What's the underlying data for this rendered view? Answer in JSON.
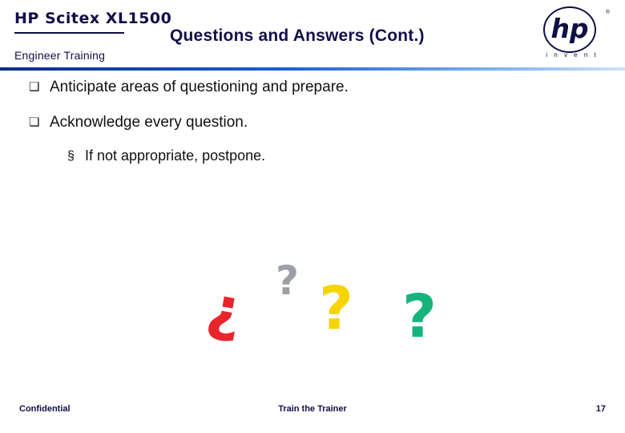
{
  "header": {
    "brand": "HP Scitex XL1500",
    "brand_sub": "Engineer  Training",
    "title": "Questions and Answers (Cont.)",
    "logo": {
      "letters": "hp",
      "tagline": "i n v e n t",
      "trademark": "®"
    },
    "accent_color": "#10104a",
    "bar_color": "#0a2c86"
  },
  "content": {
    "bullets": [
      {
        "level": 1,
        "marker": "❏",
        "text": "Anticipate areas of questioning and prepare."
      },
      {
        "level": 1,
        "marker": "❏",
        "text": "Acknowledge every question."
      },
      {
        "level": 2,
        "marker": "§",
        "text": "If not appropriate, postpone."
      }
    ]
  },
  "artwork": {
    "question_marks": [
      {
        "glyph": "?",
        "color": "#e8252a",
        "name": "question-mark-red"
      },
      {
        "glyph": "?",
        "color": "#9aa0a6",
        "name": "question-mark-gray"
      },
      {
        "glyph": "?",
        "color": "#f5d400",
        "name": "question-mark-yellow"
      },
      {
        "glyph": "?",
        "color": "#14b47c",
        "name": "question-mark-green"
      }
    ]
  },
  "footer": {
    "left": "Confidential",
    "center": "Train the Trainer",
    "page_number": "17"
  }
}
